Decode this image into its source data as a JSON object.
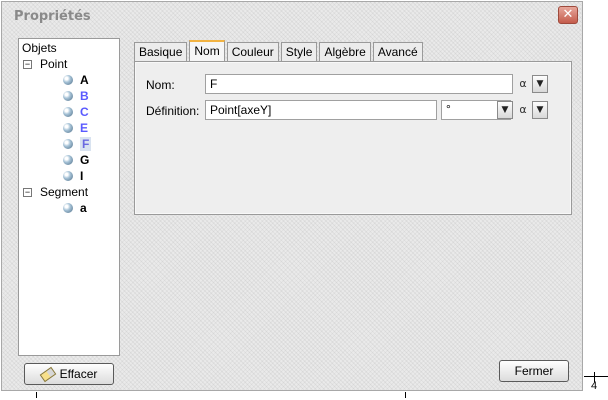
{
  "window": {
    "title": "Propriétés",
    "close_label": "✕"
  },
  "tree": {
    "root_label": "Objets",
    "groups": [
      {
        "label": "Point",
        "toggle": "⊟",
        "items": [
          {
            "label": "A",
            "color": "#000000"
          },
          {
            "label": "B",
            "color": "#5a5aff"
          },
          {
            "label": "C",
            "color": "#5a5aff"
          },
          {
            "label": "E",
            "color": "#5a5aff"
          },
          {
            "label": "F",
            "color": "#5a5aff",
            "selected": true
          },
          {
            "label": "G",
            "color": "#000000"
          },
          {
            "label": "I",
            "color": "#000000"
          }
        ]
      },
      {
        "label": "Segment",
        "toggle": "⊟",
        "items": [
          {
            "label": "a",
            "color": "#000000"
          }
        ]
      }
    ]
  },
  "tabs": [
    "Basique",
    "Nom",
    "Couleur",
    "Style",
    "Algèbre",
    "Avancé"
  ],
  "active_tab": "Nom",
  "form": {
    "name_label": "Nom:",
    "name_value": "F",
    "definition_label": "Définition:",
    "definition_value": "Point[axeY]",
    "degree_value": "°",
    "alpha_symbol": "α"
  },
  "buttons": {
    "erase_label": "Effacer",
    "close_label": "Fermer"
  },
  "background": {
    "axis_tick_label": "4"
  },
  "colors": {
    "selected_tab_accent": "#f2b342",
    "dependent_object": "#5a5aff"
  }
}
